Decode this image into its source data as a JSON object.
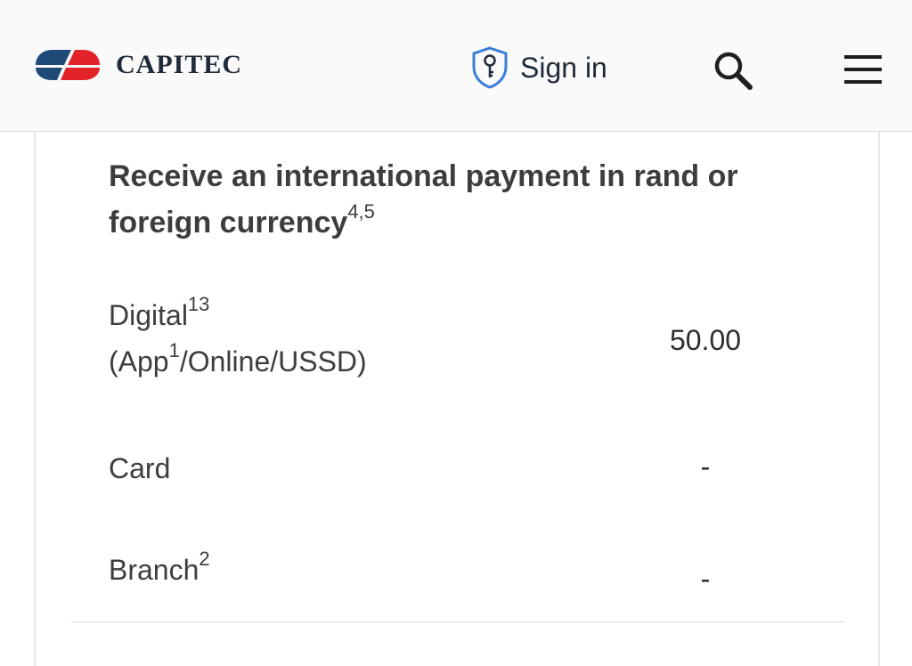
{
  "header": {
    "brand": "CAPITEC",
    "sign_in_label": "Sign in",
    "icons": {
      "logo": "capitec-logo",
      "sign_in": "shield-key-icon",
      "search": "search-icon",
      "menu": "hamburger-menu-icon"
    },
    "colors": {
      "logo_blue": "#1f4a78",
      "logo_red": "#e2232a",
      "shield_blue": "#3b7dd8"
    }
  },
  "fees": {
    "title": "Receive an international payment in rand or foreign currency",
    "title_sup": "4,5",
    "rows": [
      {
        "line1": "Digital",
        "line1_sup": "13",
        "line2_pre": "(App",
        "line2_sup": "1",
        "line2_post": "/Online/USSD)",
        "fee": "50.00"
      },
      {
        "line1": "Card",
        "fee": "-"
      },
      {
        "line1": "Branch",
        "line1_sup": "2",
        "fee": "-"
      }
    ]
  }
}
